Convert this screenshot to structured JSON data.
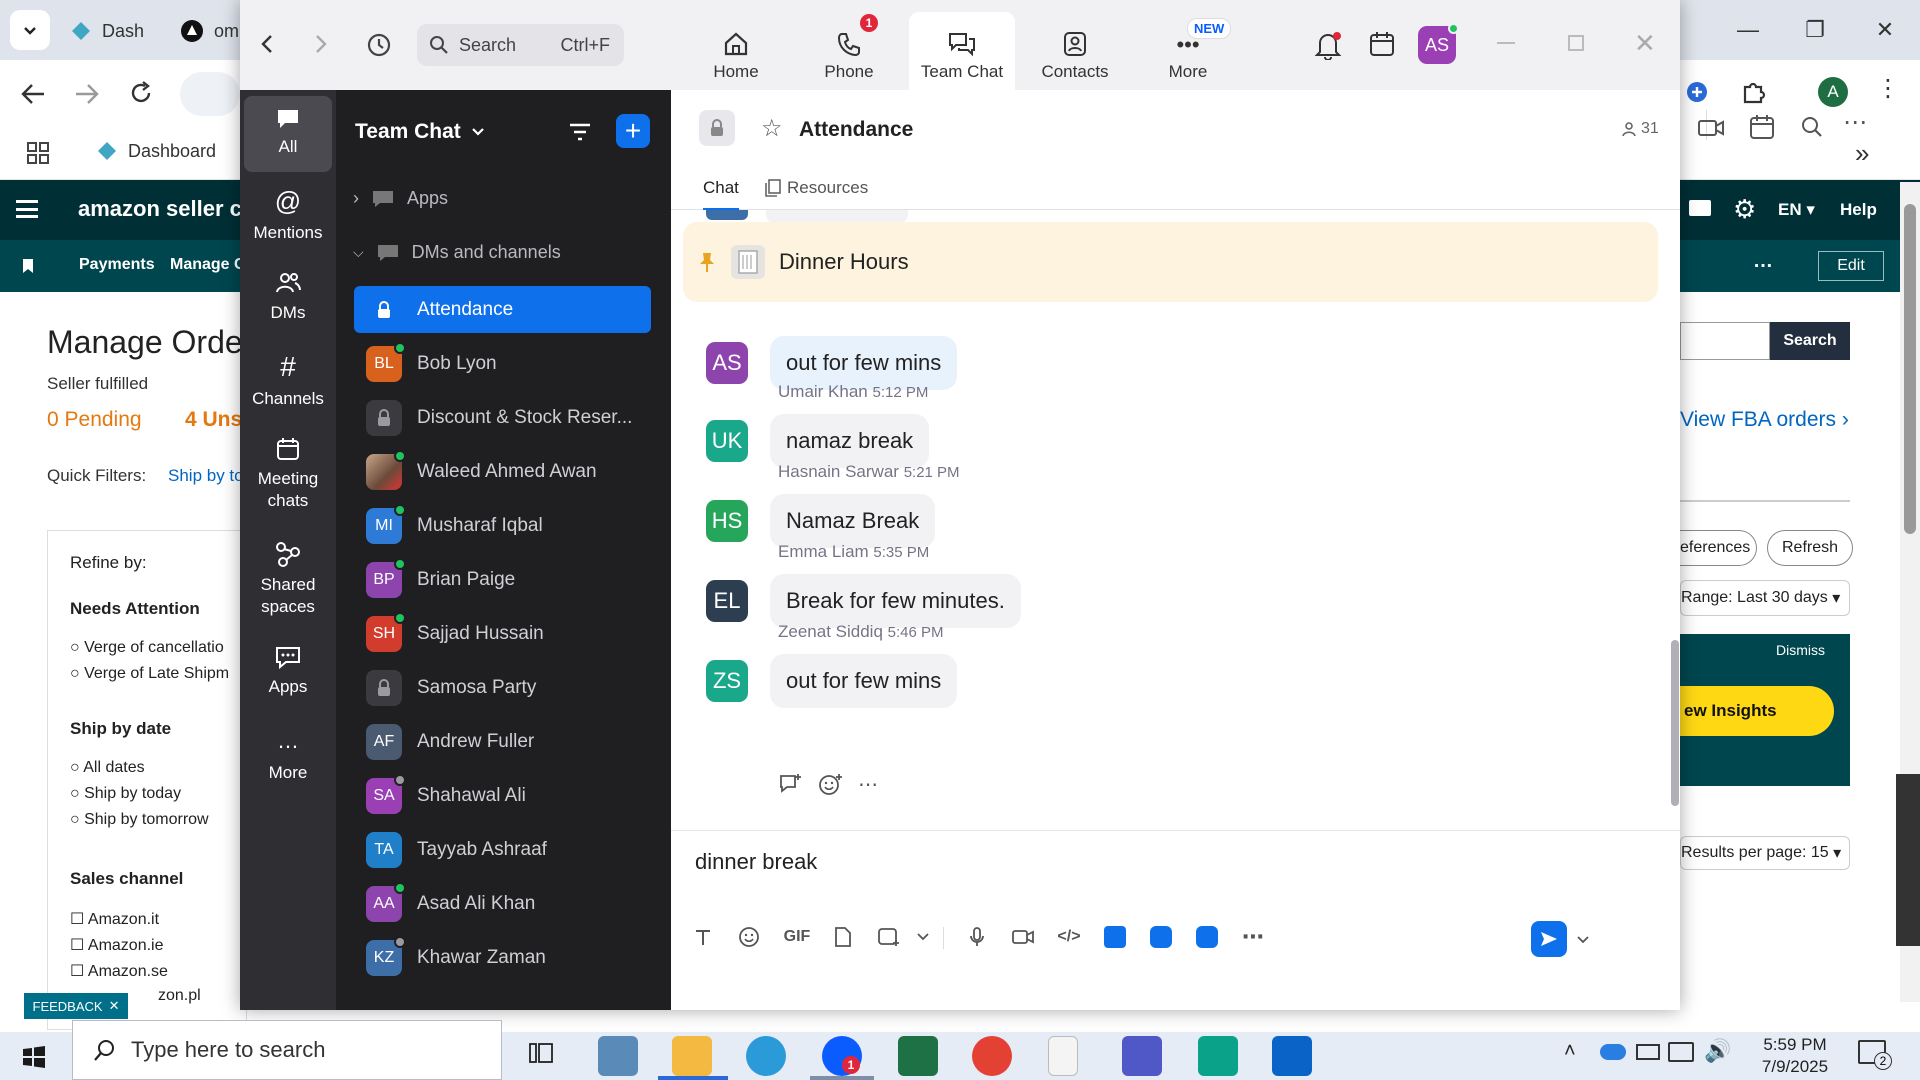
{
  "browser": {
    "tabs": [
      {
        "label": "Dash"
      },
      {
        "label": "om"
      }
    ],
    "bookmark": "Dashboard",
    "profile_letter": "A",
    "amazon": {
      "logo": "amazon seller centr",
      "nav_items": [
        "Payments",
        "Manage C"
      ],
      "lang": "EN",
      "help": "Help",
      "edit": "Edit",
      "page_title": "Manage Orde",
      "subtitle": "Seller fulfilled",
      "pending": "0 Pending",
      "unshipped": "4 Uns",
      "quick_filters_label": "Quick Filters:",
      "quick_filter_1": "Ship by to",
      "view_fba": "View FBA orders",
      "search_button": "Search",
      "preferences_button": "eferences",
      "refresh_button": "Refresh",
      "range": "Range: Last 30 days",
      "dismiss": "Dismiss",
      "insights_button": "ew Insights",
      "results_per_page": "Results per page: 15",
      "refine_by": "Refine by:",
      "needs_attention": "Needs Attention",
      "needs_attention_items": [
        "Verge of cancellatio",
        "Verge of Late Shipm"
      ],
      "ship_by_date": "Ship by date",
      "ship_by_items": [
        "All dates",
        "Ship by today",
        "Ship by tomorrow"
      ],
      "sales_channel": "Sales channel",
      "sales_channel_items": [
        "Amazon.it",
        "Amazon.ie",
        "Amazon.se",
        "zon.pl"
      ],
      "feedback": "FEEDBACK"
    }
  },
  "zoom": {
    "search_placeholder": "Search",
    "search_shortcut": "Ctrl+F",
    "nav_tabs": [
      {
        "label": "Home"
      },
      {
        "label": "Phone",
        "badge": "1"
      },
      {
        "label": "Team Chat"
      },
      {
        "label": "Contacts"
      },
      {
        "label": "More",
        "badge": "NEW"
      }
    ],
    "user_initials": "AS",
    "rail": [
      {
        "label": "All"
      },
      {
        "label": "Mentions"
      },
      {
        "label": "DMs"
      },
      {
        "label": "Channels"
      },
      {
        "label": "Meeting chats"
      },
      {
        "label": "Shared spaces"
      },
      {
        "label": "Apps"
      },
      {
        "label": "More"
      }
    ],
    "channel_panel": {
      "title": "Team Chat",
      "sections": [
        {
          "label": "Apps"
        },
        {
          "label": "DMs and channels"
        }
      ],
      "items": [
        {
          "label": "Attendance",
          "initials": "",
          "color": "#0e71eb",
          "locked": true
        },
        {
          "label": "Bob Lyon",
          "initials": "BL",
          "color": "#d9611e",
          "status": "online"
        },
        {
          "label": "Discount & Stock Reser...",
          "initials": "",
          "color": "#3a3a3f",
          "locked": true
        },
        {
          "label": "Waleed Ahmed Awan",
          "initials": "",
          "color": "#8a6a5a",
          "status": "online",
          "photo": true
        },
        {
          "label": "Musharaf Iqbal",
          "initials": "MI",
          "color": "#2d7bd6",
          "status": "online"
        },
        {
          "label": "Brian Paige",
          "initials": "BP",
          "color": "#8e44ad",
          "status": "online"
        },
        {
          "label": "Sajjad Hussain",
          "initials": "SH",
          "color": "#d23c2c",
          "status": "online"
        },
        {
          "label": "Samosa Party",
          "initials": "",
          "color": "#3a3a3f",
          "locked": true
        },
        {
          "label": "Andrew Fuller",
          "initials": "AF",
          "color": "#4a5a70"
        },
        {
          "label": "Shahawal Ali",
          "initials": "SA",
          "color": "#9b3fb5",
          "status": "away"
        },
        {
          "label": "Tayyab Ashraaf",
          "initials": "TA",
          "color": "#1f7fc9"
        },
        {
          "label": "Asad Ali Khan",
          "initials": "AA",
          "color": "#8e44ad",
          "status": "online"
        },
        {
          "label": "Khawar Zaman",
          "initials": "KZ",
          "color": "#3e6ea8",
          "status": "away"
        }
      ]
    },
    "chat": {
      "title": "Attendance",
      "member_count": "31",
      "tabs": [
        {
          "label": "Chat"
        },
        {
          "label": "Resources"
        }
      ],
      "pinned": "Dinner Hours",
      "messages": [
        {
          "initials": "AS",
          "color": "#8e44ad",
          "name": "",
          "time": "",
          "text": "out for few mins"
        },
        {
          "initials": "UK",
          "color": "#1aa88a",
          "name": "Umair Khan",
          "time": "5:12 PM",
          "text": "namaz break"
        },
        {
          "initials": "HS",
          "color": "#26a65b",
          "name": "Hasnain Sarwar",
          "time": "5:21 PM",
          "text": "Namaz Break"
        },
        {
          "initials": "EL",
          "color": "#2c3e50",
          "name": "Emma Liam",
          "time": "5:35 PM",
          "text": "Break for few minutes."
        },
        {
          "initials": "ZS",
          "color": "#1aa88a",
          "name": "Zeenat Siddiq",
          "time": "5:46 PM",
          "text": "out for few mins"
        }
      ],
      "composer_text": "dinner break",
      "gif_label": "GIF"
    }
  },
  "taskbar": {
    "search_placeholder": "Type here to search",
    "time": "5:59 PM",
    "date": "7/9/2025",
    "notif_count": "2",
    "zoom_badge": "1"
  }
}
